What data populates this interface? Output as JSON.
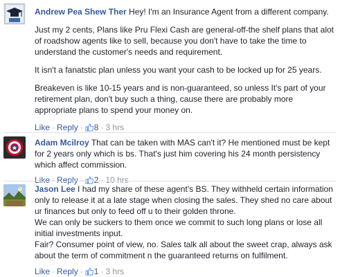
{
  "colors": {
    "link": "#365899",
    "text": "#1d2129",
    "meta": "#90949c",
    "like": "#5890ff"
  },
  "comments": [
    {
      "author": "Andrew Pea Shew Ther",
      "avatar_icon": "graduation-cap-avatar-icon",
      "paragraphs": [
        "Hey! I'm an Insurance Agent from a different company.",
        "Just my 2 cents, Plans like Pru Flexi Cash are general-off-the shelf plans that alot",
        "of roadshow agents like to sell, because you don't have to take the time to",
        "understand the customer's needs and requirement.",
        "It isn't a fanatstic plan unless you want your cash to be locked up for 25 years.",
        "Breakeven is like 10-15 years and is non-guaranteed, so unless It's part of your",
        "retirement plan, don't buy such a thing, cause there are probably more",
        "appropriate plans to spend your money on."
      ],
      "like_label": "Like",
      "reply_label": "Reply",
      "likes": "8",
      "time": "3 hrs"
    },
    {
      "author": "Adam Mcilroy",
      "avatar_icon": "shield-avatar-icon",
      "paragraphs": [
        "That can be taken with MAS can't it? He mentioned must be kept",
        "for 2 years only which is bs. That's just him covering his 24 month persistency",
        "which affect commission."
      ],
      "like_label": "Like",
      "reply_label": "Reply",
      "likes": "2",
      "time": "10 hrs"
    },
    {
      "author": "Jason Lee",
      "avatar_icon": "landscape-avatar-icon",
      "paragraphs": [
        "I had my share of these agent's BS. They withheld certain information",
        "only to release it at a late stage when closing the sales. They shed no care about",
        "ur finances but only to feed off u to their golden throne.",
        "We can only be suckers to them once we commit to such long plans or lose all",
        "initial investments input.",
        "Fair? Consumer point of view, no. Sales talk all about the sweet crap, always ask",
        "about the term of commitment n the guaranteed returns on fulfilment."
      ],
      "like_label": "Like",
      "reply_label": "Reply",
      "likes": "1",
      "time": "3 hrs"
    }
  ]
}
